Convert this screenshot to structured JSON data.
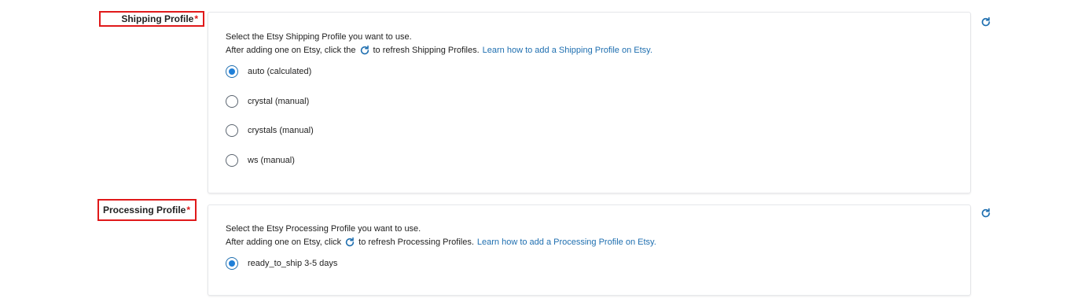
{
  "shipping": {
    "label": "Shipping Profile",
    "required_mark": "*",
    "desc_line1": "Select the Etsy Shipping Profile you want to use.",
    "desc_line2_before": "After adding one on Etsy, click the",
    "desc_line2_after": "to refresh Shipping Profiles.",
    "link": "Learn how to add a Shipping Profile on Etsy.",
    "options": [
      "auto (calculated)",
      "crystal (manual)",
      "crystals (manual)",
      "ws (manual)"
    ],
    "selected": "auto (calculated)"
  },
  "processing": {
    "label": "Processing Profile",
    "required_mark": "*",
    "desc_line1": "Select the Etsy Processing Profile you want to use.",
    "desc_line2_before": "After adding one on Etsy, click",
    "desc_line2_after": "to refresh Processing Profiles.",
    "link": "Learn how to add a Processing Profile on Etsy.",
    "options": [
      "ready_to_ship 3-5 days"
    ],
    "selected": "ready_to_ship 3-5 days"
  },
  "colors": {
    "accent": "#1f7fd8",
    "link": "#1f6fb0",
    "required": "#e0191a",
    "highlight_border": "#e0191a"
  },
  "icons": {
    "refresh": "refresh-icon"
  }
}
